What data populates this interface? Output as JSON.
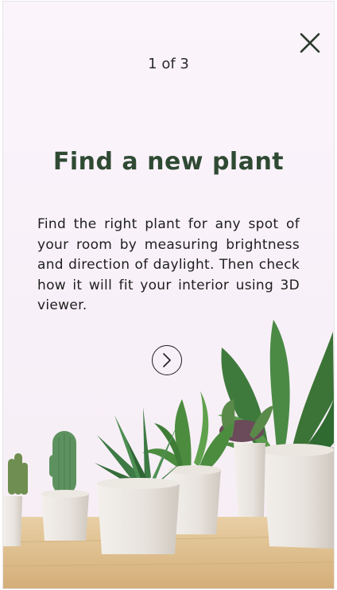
{
  "onboarding": {
    "pager": "1 of 3",
    "title": "Find a new plant",
    "description": "Find the right plant for any spot of your room by measuring brightness and direction of daylight. Then check how it will fit your interior using 3D viewer."
  },
  "icons": {
    "close": "close-icon",
    "next": "chevron-right-icon"
  },
  "colors": {
    "title": "#2f4a33",
    "background": "#f8f0f8",
    "table": "#d9b98a"
  }
}
